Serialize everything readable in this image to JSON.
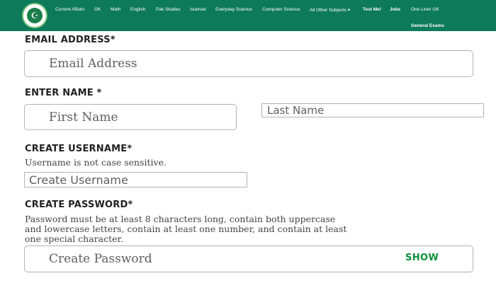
{
  "nav": {
    "items": [
      "Current Affairs",
      "GK",
      "Math",
      "English",
      "Pak Studies",
      "Islamiat",
      "Everyday Science",
      "Computer Science",
      "All Other Subjects ▾",
      "Test Me!",
      "Jobs",
      "One Liner GK"
    ],
    "sub_item": "General Exams",
    "colors": {
      "bar": "#0d7a5a",
      "text": "#ffffff"
    }
  },
  "form": {
    "email": {
      "label": "EMAIL ADDRESS*",
      "placeholder": "Email Address"
    },
    "name": {
      "label": "ENTER NAME *",
      "first_placeholder": "First Name",
      "last_placeholder": "Last Name"
    },
    "username": {
      "label": "CREATE USERNAME*",
      "hint": "Username is not case sensitive.",
      "placeholder": "Create Username"
    },
    "password": {
      "label": "CREATE PASSWORD*",
      "hint_lines": [
        "Password must be at least 8 characters long, contain both uppercase",
        "and lowercase letters, contain at least one number, and contain at least",
        "one special character."
      ],
      "placeholder": "Create Password",
      "show_label": "SHOW"
    },
    "accent_color": "#0a8f3c"
  }
}
